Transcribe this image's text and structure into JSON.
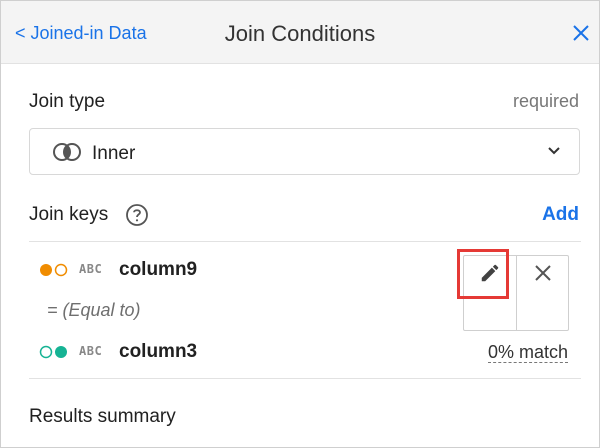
{
  "header": {
    "back_label": "< Joined-in Data",
    "title": "Join Conditions",
    "close_icon": "close-icon"
  },
  "join_type": {
    "label": "Join type",
    "required_text": "required",
    "selected_value": "Inner",
    "selected_icon": "venn-inner-icon"
  },
  "join_keys": {
    "label": "Join keys",
    "help_icon": "help-icon",
    "add_label": "Add",
    "conditions": [
      {
        "left": {
          "type_badge": "ABC",
          "name": "column9",
          "indicator_color": "#f08c00"
        },
        "operator": "= (Equal to)",
        "right": {
          "type_badge": "ABC",
          "name": "column3",
          "indicator_color": "#16b394"
        },
        "match": "0% match"
      }
    ]
  },
  "results_summary": {
    "label": "Results summary"
  },
  "colors": {
    "accent": "#1a73e8",
    "highlight": "#e53935"
  }
}
